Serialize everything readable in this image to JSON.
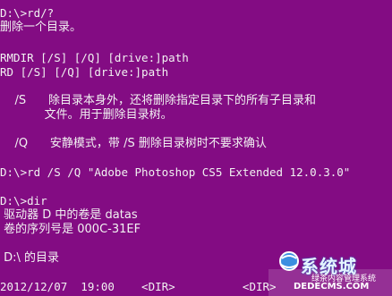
{
  "console": {
    "lines": [
      "D:\\>rd/?",
      "删除一个目录。",
      "",
      "RMDIR [/S] [/Q] [drive:]path",
      "RD [/S] [/Q] [drive:]path",
      "",
      "    /S      除目录本身外，还将删除指定目录下的所有子目录和",
      "            文件。用于删除目录树。",
      "",
      "    /Q      安静模式，带 /S 删除目录树时不要求确认",
      "",
      "D:\\>rd /S /Q \"Adobe Photoshop CS5 Extended 12.0.3.0\"",
      "",
      "D:\\>dir",
      " 驱动器 D 中的卷是 datas",
      " 卷的序列号是 000C-31EF",
      "",
      " D:\\ 的目录",
      "",
      "2012/12/07  19:00    <DIR>          <DIR>"
    ]
  },
  "colors": {
    "background": "#830c83",
    "text": "#f2f2f2"
  },
  "watermark": {
    "title": "系统城",
    "subtitle": "绿茶内容管理系统",
    "url": "DEDECMS.COM"
  }
}
